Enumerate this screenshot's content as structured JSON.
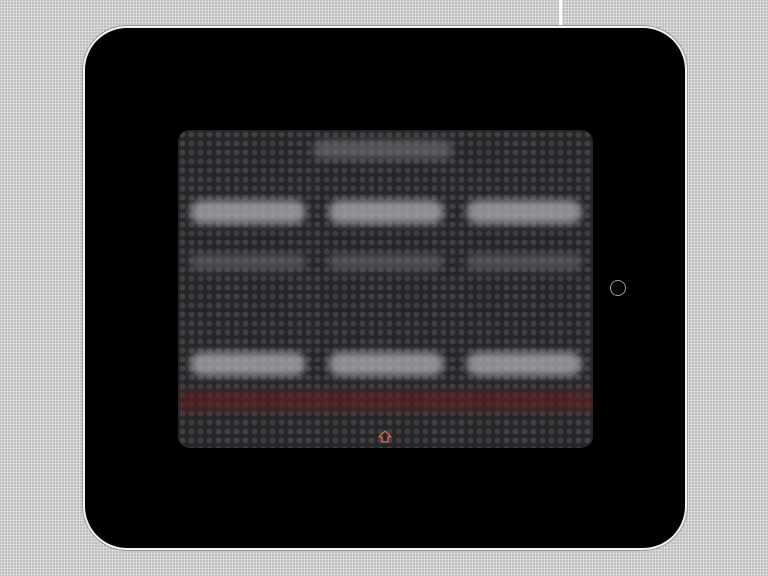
{
  "device": {
    "kind": "tablet-simulator",
    "state": "content-blurred"
  },
  "screen": {
    "overlay": "blurred",
    "tiles": [
      {
        "row": 1,
        "col": 1
      },
      {
        "row": 1,
        "col": 2
      },
      {
        "row": 1,
        "col": 3
      },
      {
        "row": 2,
        "col": 1
      },
      {
        "row": 2,
        "col": 2
      },
      {
        "row": 2,
        "col": 3
      },
      {
        "row": 3,
        "col": 1
      },
      {
        "row": 3,
        "col": 2
      },
      {
        "row": 3,
        "col": 3
      }
    ],
    "home_indicator_icon": "home-arrow-icon"
  },
  "colors": {
    "device_body": "#000000",
    "device_border": "#f4f4f4",
    "screen_base": "#262628",
    "accent": "#d2694a",
    "background": "#c9c9c9"
  }
}
